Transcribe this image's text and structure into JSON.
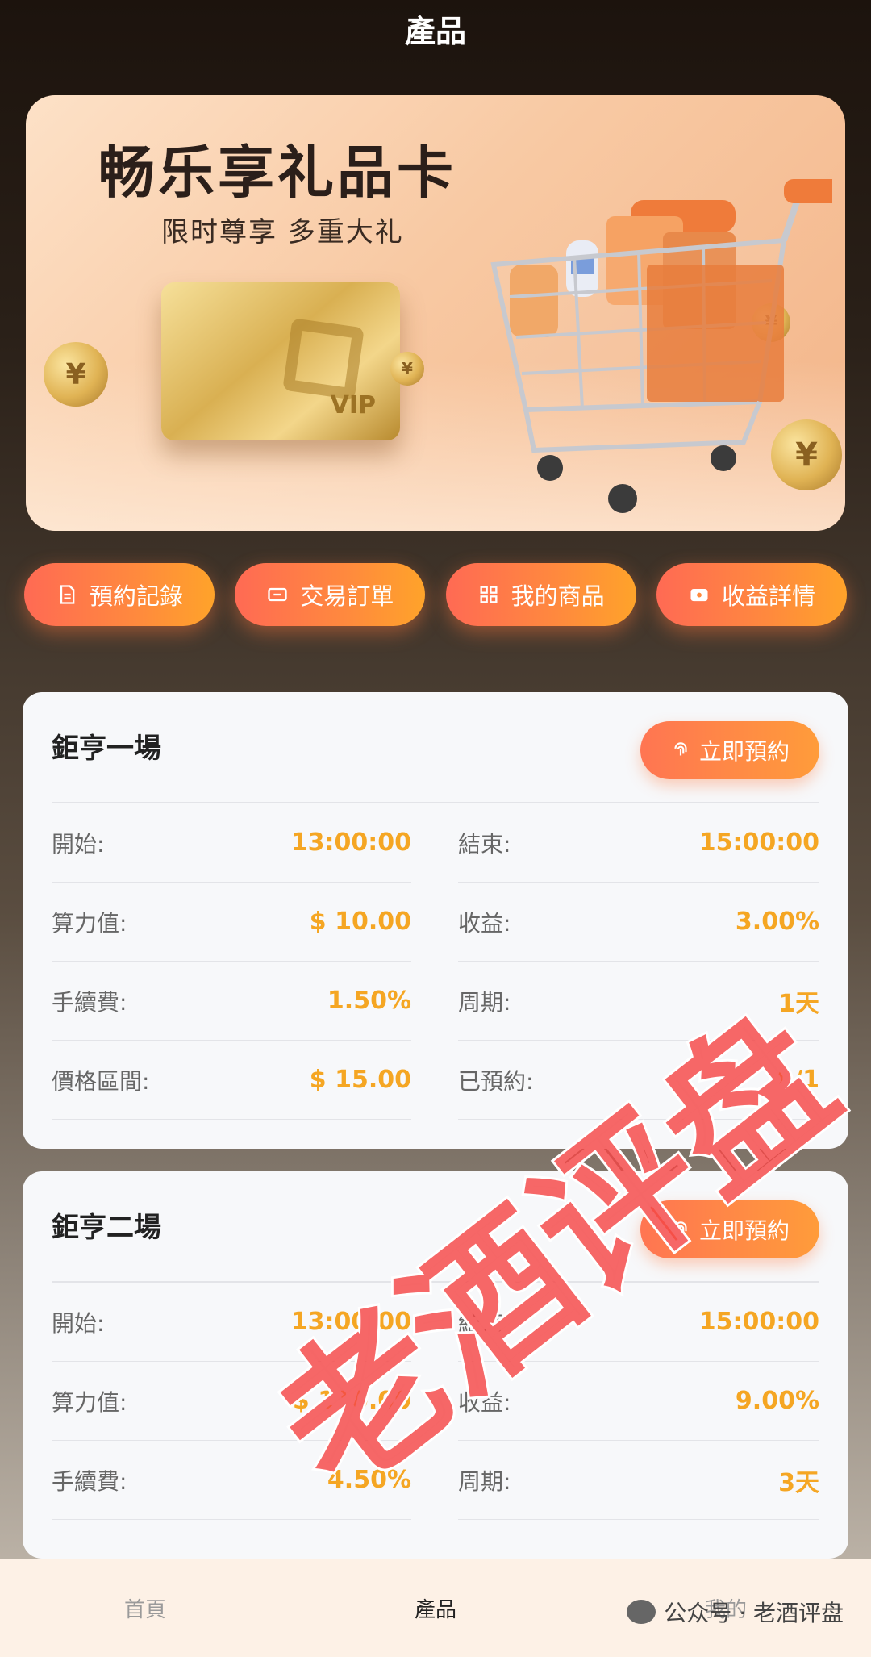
{
  "header": {
    "title": "產品"
  },
  "banner": {
    "headline": "畅乐享礼品卡",
    "subline": "限时尊享 多重大礼",
    "card_label": "VIP"
  },
  "shortcuts": [
    {
      "label": "預約記錄",
      "icon": "document-icon"
    },
    {
      "label": "交易訂單",
      "icon": "ticket-icon"
    },
    {
      "label": "我的商品",
      "icon": "grid-icon"
    },
    {
      "label": "收益詳情",
      "icon": "wallet-icon"
    }
  ],
  "products": [
    {
      "title": "鉅亨一場",
      "button": "立即預約",
      "fields": {
        "start_label": "開始:",
        "start": "13:00:00",
        "end_label": "結束:",
        "end": "15:00:00",
        "power_label": "算力值:",
        "power": "$ 10.00",
        "yield_label": "收益:",
        "yield": "3.00%",
        "fee_label": "手續費:",
        "fee": "1.50%",
        "period_label": "周期:",
        "period": "1天",
        "price_label": "價格區間:",
        "price": "$ 15.00",
        "booked_label": "已預約:",
        "booked": "0/1"
      }
    },
    {
      "title": "鉅亨二場",
      "button": "立即預約",
      "fields": {
        "start_label": "開始:",
        "start": "13:00:00",
        "end_label": "結束:",
        "end": "15:00:00",
        "power_label": "算力值:",
        "power": "$ 110.00",
        "yield_label": "收益:",
        "yield": "9.00%",
        "fee_label": "手續費:",
        "fee": "4.50%",
        "period_label": "周期:",
        "period": "3天"
      }
    }
  ],
  "tabbar": [
    {
      "label": "首頁"
    },
    {
      "label": "產品"
    },
    {
      "label": "我的"
    }
  ],
  "watermark": {
    "stamp": "老酒评盘",
    "wechat": "公众号 · 老酒评盘"
  },
  "colors": {
    "accent": "#ff8a3d",
    "value": "#f5a623",
    "watermark": "#f44646"
  }
}
